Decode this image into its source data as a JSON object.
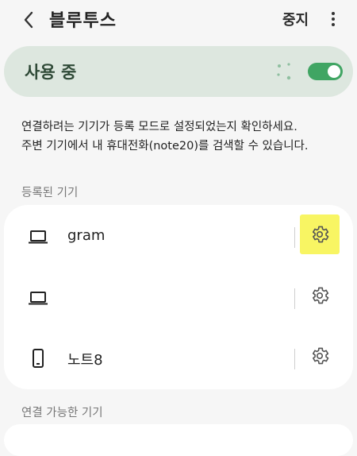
{
  "header": {
    "title": "블루투스",
    "stop_label": "중지"
  },
  "status": {
    "label": "사용 중",
    "toggle_on": true,
    "accent_color": "#40a563"
  },
  "info": {
    "line1": "연결하려는 기기가 등록 모드로 설정되었는지 확인하세요.",
    "line2": "주변 기기에서 내 휴대전화(note20)를 검색할 수 있습니다."
  },
  "registered": {
    "header": "등록된 기기",
    "devices": [
      {
        "name": "gram",
        "icon": "laptop-icon",
        "settings_highlighted": true
      },
      {
        "name": "",
        "icon": "laptop-icon",
        "settings_highlighted": false
      },
      {
        "name": "노트8",
        "icon": "phone-icon",
        "settings_highlighted": false
      }
    ]
  },
  "available": {
    "header": "연결 가능한 기기"
  }
}
